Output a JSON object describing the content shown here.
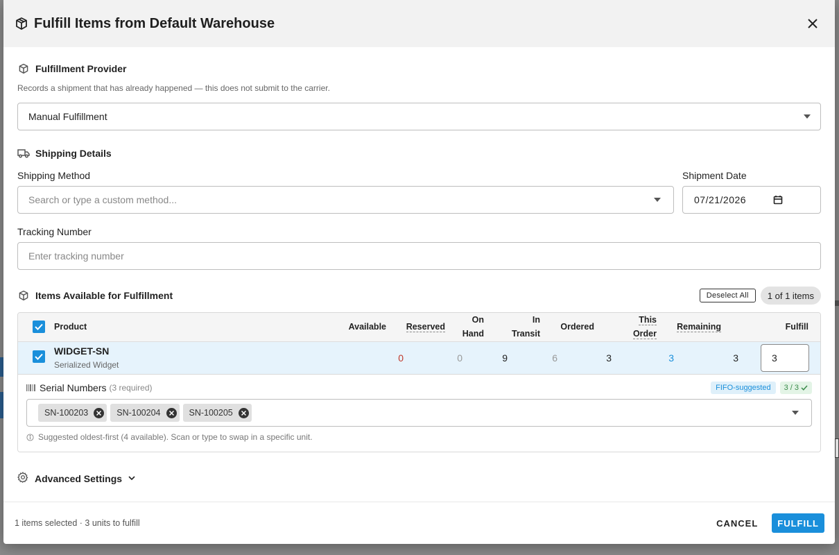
{
  "modal": {
    "title": "Fulfill Items from Default Warehouse"
  },
  "provider": {
    "heading": "Fulfillment Provider",
    "description": "Records a shipment that has already happened — this does not submit to the carrier.",
    "selected": "Manual Fulfillment"
  },
  "shipping": {
    "heading": "Shipping Details",
    "method_label": "Shipping Method",
    "method_placeholder": "Search or type a custom method...",
    "date_label": "Shipment Date",
    "date_value": "07/21/2026",
    "tracking_label": "Tracking Number",
    "tracking_placeholder": "Enter tracking number"
  },
  "items": {
    "heading": "Items Available for Fulfillment",
    "deselect_label": "Deselect All",
    "count_label": "1 of 1 items",
    "columns": {
      "product": "Product",
      "available": "Available",
      "reserved": "Reserved",
      "on_hand_1": "On",
      "on_hand_2": "Hand",
      "in_transit_1": "In",
      "in_transit_2": "Transit",
      "ordered": "Ordered",
      "this_order_1": "This",
      "this_order_2": "Order",
      "remaining": "Remaining",
      "fulfill": "Fulfill"
    },
    "rows": [
      {
        "sku": "WIDGET-SN",
        "name": "Serialized Widget",
        "available": "0",
        "reserved": "0",
        "on_hand": "9",
        "in_transit": "6",
        "ordered": "3",
        "this_order": "3",
        "remaining": "3",
        "fulfill": "3"
      }
    ]
  },
  "serials": {
    "title": "Serial Numbers",
    "required": "(3 required)",
    "fifo_badge": "FIFO-suggested",
    "count_badge": "3 / 3",
    "chips": [
      "SN-100203",
      "SN-100204",
      "SN-100205"
    ],
    "hint": "Suggested oldest-first (4 available). Scan or type to swap in a specific unit."
  },
  "advanced": {
    "label": "Advanced Settings"
  },
  "footer": {
    "status": "1 items selected · 3 units to fulfill",
    "cancel": "CANCEL",
    "fulfill": "FULFILL"
  },
  "colors": {
    "accent": "#1a8fdb",
    "danger": "#c0392b",
    "muted": "#999999",
    "success": "#3a8a4a"
  },
  "icons": [
    "box-icon",
    "truck-icon",
    "close-icon",
    "chevron-down-icon",
    "calendar-icon",
    "check-icon",
    "barcode-icon",
    "info-icon",
    "gear-icon",
    "remove-chip-icon"
  ]
}
